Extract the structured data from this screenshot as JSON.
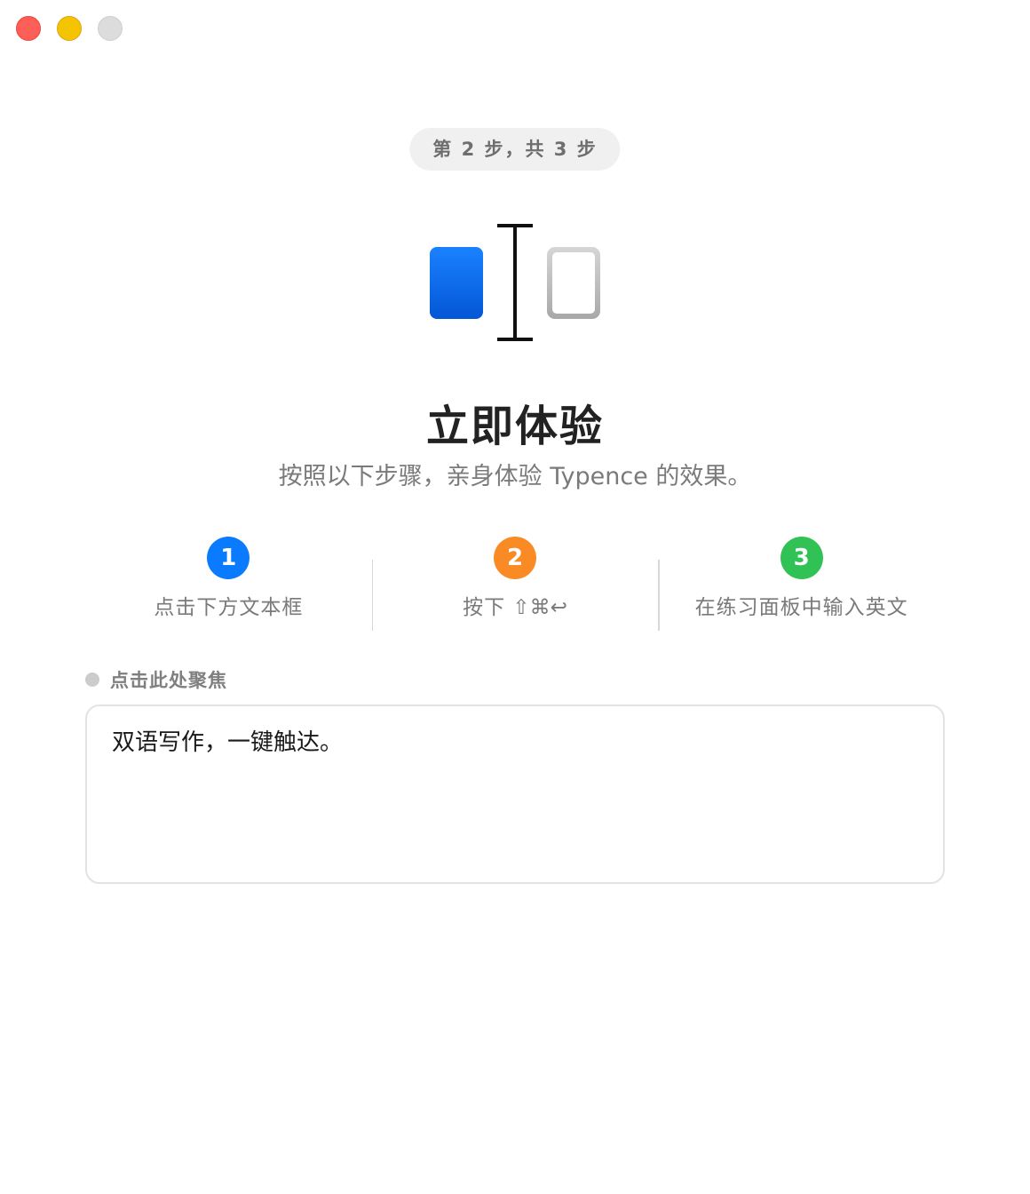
{
  "window": {
    "controls": {
      "close": "close-icon",
      "minimize": "minimize-icon",
      "zoom": "zoom-icon"
    }
  },
  "step_indicator": "第 2 步，共 3 步",
  "hero": {
    "icon": "text-cursor-between-boxes-icon",
    "colors": {
      "left_box": "#0a6cf0",
      "right_box": "#c8c8c8",
      "cursor": "#111111"
    }
  },
  "title": "立即体验",
  "subtitle": "按照以下步骤，亲身体验 Typence 的效果。",
  "steps": [
    {
      "number": "1",
      "label": "点击下方文本框",
      "color": "#0a7aff"
    },
    {
      "number": "2",
      "label": "按下",
      "keys": "⇧⌘↩",
      "color": "#fa8a23"
    },
    {
      "number": "3",
      "label": "在练习面板中输入英文",
      "color": "#30c254"
    }
  ],
  "focus_hint": {
    "label": "点击此处聚焦",
    "dot_color": "#cccccc"
  },
  "practice_input": {
    "value": "双语写作，一键触达。"
  }
}
